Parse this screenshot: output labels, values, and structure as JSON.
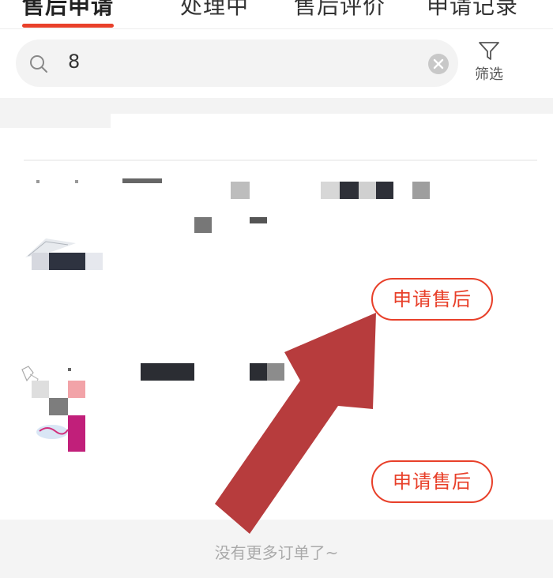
{
  "tabs": [
    {
      "label": "售后申请",
      "active": true
    },
    {
      "label": "处理中",
      "active": false
    },
    {
      "label": "售后评价",
      "active": false
    },
    {
      "label": "申请记录",
      "active": false
    }
  ],
  "search": {
    "value": "8",
    "icon": "search-icon",
    "clear_icon": "clear-icon"
  },
  "filter": {
    "label": "筛选",
    "icon": "filter-icon"
  },
  "orders": [
    {
      "action_label": "申请售后"
    },
    {
      "action_label": "申请售后"
    }
  ],
  "footer": {
    "text": "没有更多订单了~"
  },
  "colors": {
    "accent": "#e8402a",
    "arrow": "#b53637",
    "background": "#ffffff",
    "muted": "#aaaaaa"
  }
}
